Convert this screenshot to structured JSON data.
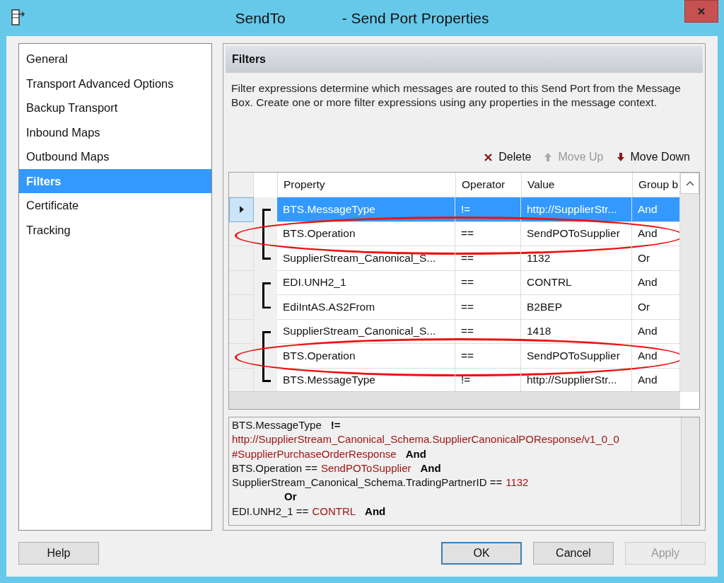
{
  "window": {
    "title_start": "SendTo",
    "title_end": "- Send Port Properties"
  },
  "sidebar": {
    "items": [
      {
        "label": "General",
        "selected": false
      },
      {
        "label": "Transport Advanced Options",
        "selected": false
      },
      {
        "label": "Backup Transport",
        "selected": false
      },
      {
        "label": "Inbound Maps",
        "selected": false
      },
      {
        "label": "Outbound Maps",
        "selected": false
      },
      {
        "label": "Filters",
        "selected": true
      },
      {
        "label": "Certificate",
        "selected": false
      },
      {
        "label": "Tracking",
        "selected": false
      }
    ]
  },
  "panel": {
    "title": "Filters",
    "description": "Filter expressions determine which messages are routed to this Send Port from the Message Box. Create one or more filter expressions using any properties in the message context."
  },
  "toolbar": [
    {
      "kind": "delete",
      "label": "Delete",
      "disabled": false
    },
    {
      "kind": "up",
      "label": "Move Up",
      "disabled": true
    },
    {
      "kind": "down",
      "label": "Move Down",
      "disabled": false
    }
  ],
  "table": {
    "columns": [
      "Property",
      "Operator",
      "Value",
      "Group b"
    ],
    "groups": [
      {
        "rows": [
          {
            "property": "BTS.MessageType",
            "operator": "!=",
            "value": "http://SupplierStr...",
            "group_by": "And",
            "selected": true,
            "circled": false
          },
          {
            "property": "BTS.Operation",
            "operator": "==",
            "value": "SendPOToSupplier",
            "group_by": "And",
            "selected": false,
            "circled": true
          },
          {
            "property": "SupplierStream_Canonical_S...",
            "operator": "==",
            "value": "1132",
            "group_by": "Or",
            "selected": false,
            "circled": false
          }
        ]
      },
      {
        "rows": [
          {
            "property": "EDI.UNH2_1",
            "operator": "==",
            "value": "CONTRL",
            "group_by": "And",
            "selected": false,
            "circled": false
          },
          {
            "property": "EdiIntAS.AS2From",
            "operator": "==",
            "value": "B2BEP",
            "group_by": "Or",
            "selected": false,
            "circled": false
          }
        ]
      },
      {
        "rows": [
          {
            "property": "SupplierStream_Canonical_S...",
            "operator": "==",
            "value": "1418",
            "group_by": "And",
            "selected": false,
            "circled": false
          },
          {
            "property": "BTS.Operation",
            "operator": "==",
            "value": "SendPOToSupplier",
            "group_by": "And",
            "selected": false,
            "circled": true
          },
          {
            "property": "BTS.MessageType",
            "operator": "!=",
            "value": "http://SupplierStr...",
            "group_by": "And",
            "selected": false,
            "circled": false
          }
        ]
      }
    ]
  },
  "expression": {
    "lines": [
      [
        {
          "kind": "plain",
          "text": "BTS.MessageType"
        },
        {
          "kind": "operator",
          "text": "!="
        }
      ],
      [
        {
          "kind": "value",
          "text": "http://SupplierStream_Canonical_Schema.SupplierCanonicalPOResponse/v1_0_0"
        }
      ],
      [
        {
          "kind": "value",
          "text": "#SupplierPurchaseOrderResponse"
        },
        {
          "kind": "operator",
          "text": "And"
        }
      ],
      [
        {
          "kind": "plain",
          "text": "BTS.Operation =="
        },
        {
          "kind": "value",
          "text": "SendPOToSupplier"
        },
        {
          "kind": "operator",
          "text": "And"
        }
      ],
      [
        {
          "kind": "plain",
          "text": "SupplierStream_Canonical_Schema.TradingPartnerID =="
        },
        {
          "kind": "value",
          "text": "1132"
        }
      ],
      [
        {
          "kind": "group",
          "text": "Or"
        }
      ],
      [
        {
          "kind": "plain",
          "text": "EDI.UNH2_1 =="
        },
        {
          "kind": "value",
          "text": "CONTRL"
        },
        {
          "kind": "operator",
          "text": "And"
        }
      ]
    ]
  },
  "buttons": [
    {
      "label": "Help",
      "kind": "help",
      "disabled": false,
      "default": false
    },
    {
      "label": "OK",
      "kind": "ok",
      "disabled": false,
      "default": true
    },
    {
      "label": "Cancel",
      "kind": "cancel",
      "disabled": false,
      "default": false
    },
    {
      "label": "Apply",
      "kind": "apply",
      "disabled": true,
      "default": false
    }
  ]
}
